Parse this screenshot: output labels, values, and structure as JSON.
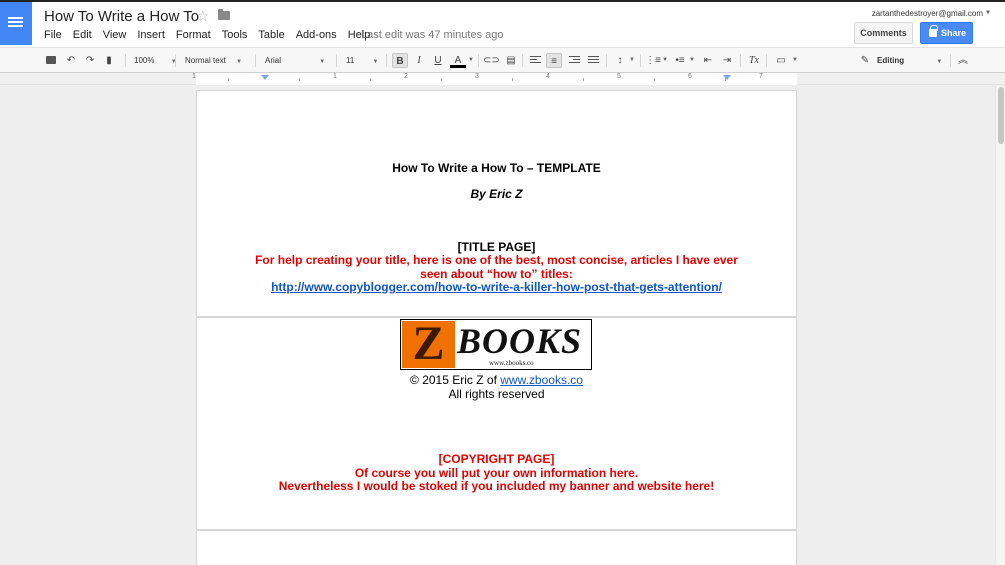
{
  "app": {
    "doc_title": "How To Write a How To",
    "last_edit": "Last edit was 47 minutes ago",
    "account_email": "zartanthedestroyer@gmail.com",
    "comments_label": "Comments",
    "share_label": "Share",
    "accent_color": "#4285f4"
  },
  "menu": [
    "File",
    "Edit",
    "View",
    "Insert",
    "Format",
    "Tools",
    "Table",
    "Add-ons",
    "Help"
  ],
  "toolbar": {
    "zoom": "100%",
    "style": "Normal text",
    "font": "Arial",
    "font_size": "11",
    "bold": "B",
    "italic": "I",
    "underline": "U",
    "text_color": "A",
    "clear_format": "Tx",
    "mode": "Editing"
  },
  "ruler": [
    "1",
    "1",
    "2",
    "3",
    "4",
    "5",
    "6",
    "7"
  ],
  "document": {
    "page1": {
      "title": "How To Write a How To – TEMPLATE",
      "byline": "By Eric Z",
      "section_heading": "[TITLE PAGE]",
      "help_line1": "For help creating your title, here is one of the best, most concise, articles I have ever",
      "help_line2": "seen about “how to” titles:",
      "help_link": "http://www.copyblogger.com/how-to-write-a-killer-how-post-that-gets-attention/"
    },
    "page2": {
      "banner_letter": "Z",
      "banner_word": "BOOKS",
      "banner_url": "www.zbooks.co",
      "copyright_prefix": "© 2015 Eric Z of ",
      "copyright_link": "www.zbooks.co",
      "rights": "All rights reserved",
      "section_heading": "[COPYRIGHT PAGE]",
      "note_line1": "Of course you will put your own information here.",
      "note_line2": "Nevertheless I would be stoked if you included my banner and website here!"
    }
  }
}
